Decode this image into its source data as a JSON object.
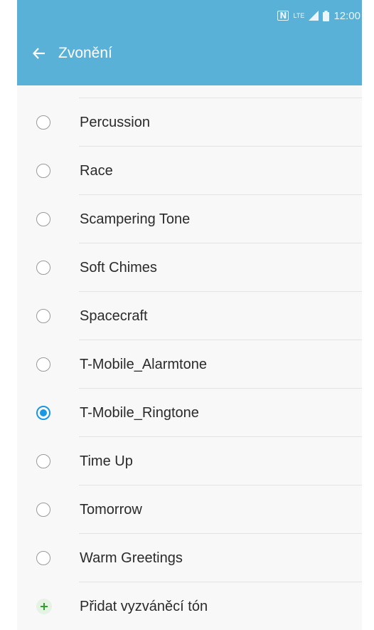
{
  "status_bar": {
    "nfc_icon": "nfc-icon",
    "network_label": "LTE",
    "signal_icon": "signal-icon",
    "battery_icon": "battery-icon",
    "time": "12:00"
  },
  "header": {
    "back_icon": "arrow-left-icon",
    "title": "Zvonění"
  },
  "ringtones": {
    "items": [
      {
        "label": "Percussion",
        "selected": false
      },
      {
        "label": "Race",
        "selected": false
      },
      {
        "label": "Scampering Tone",
        "selected": false
      },
      {
        "label": "Soft Chimes",
        "selected": false
      },
      {
        "label": "Spacecraft",
        "selected": false
      },
      {
        "label": "T-Mobile_Alarmtone",
        "selected": false
      },
      {
        "label": "T-Mobile_Ringtone",
        "selected": true
      },
      {
        "label": "Time Up",
        "selected": false
      },
      {
        "label": "Tomorrow",
        "selected": false
      },
      {
        "label": "Warm Greetings",
        "selected": false
      }
    ]
  },
  "add_ringtone": {
    "icon": "plus-icon",
    "label": "Přidat vyzváněcí tón"
  },
  "colors": {
    "header_bg": "#5ab1d8",
    "accent": "#1a96e6",
    "background": "#f8f8f8",
    "add_icon": "#2ea02e"
  }
}
